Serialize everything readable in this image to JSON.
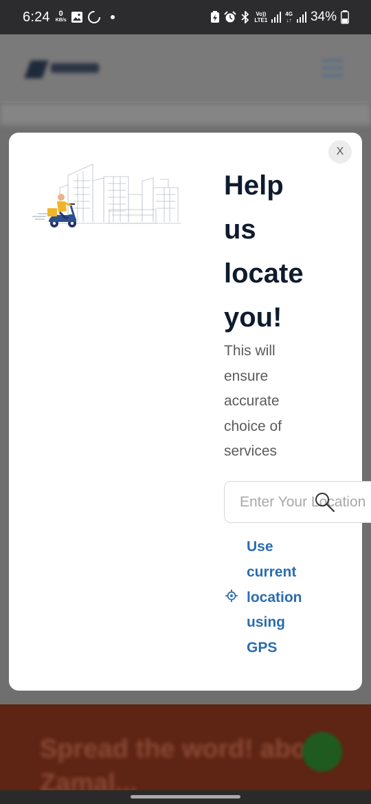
{
  "status_bar": {
    "time": "6:24",
    "net_speed_value": "0",
    "net_speed_unit": "KB/s",
    "volte_label_top": "Vo))",
    "volte_label_bottom": "LTE1",
    "network_type": "4G",
    "battery_percent": "34%",
    "icons": [
      "gallery-icon",
      "loading-icon",
      "dot-icon",
      "battery-saver-icon",
      "alarm-icon",
      "bluetooth-icon",
      "signal-icon",
      "signal-icon",
      "battery-icon"
    ]
  },
  "background_page": {
    "banner_text": "Spread the word! about Zamal..."
  },
  "modal": {
    "close_label": "X",
    "heading_lines": [
      "Help",
      "us",
      "locate",
      "you!"
    ],
    "subtext_lines": [
      "This will",
      "ensure",
      "accurate",
      "choice of",
      "services"
    ],
    "search": {
      "placeholder": "Enter Your Location",
      "value": ""
    },
    "gps_lines": [
      "Use",
      "current",
      "location",
      "using",
      "GPS"
    ],
    "colors": {
      "heading": "#0f1b2e",
      "subtext": "#5b5b5b",
      "gps_link": "#2b6cb0",
      "scooter": "#2b4f8f",
      "rider_shirt": "#f0b429"
    }
  }
}
